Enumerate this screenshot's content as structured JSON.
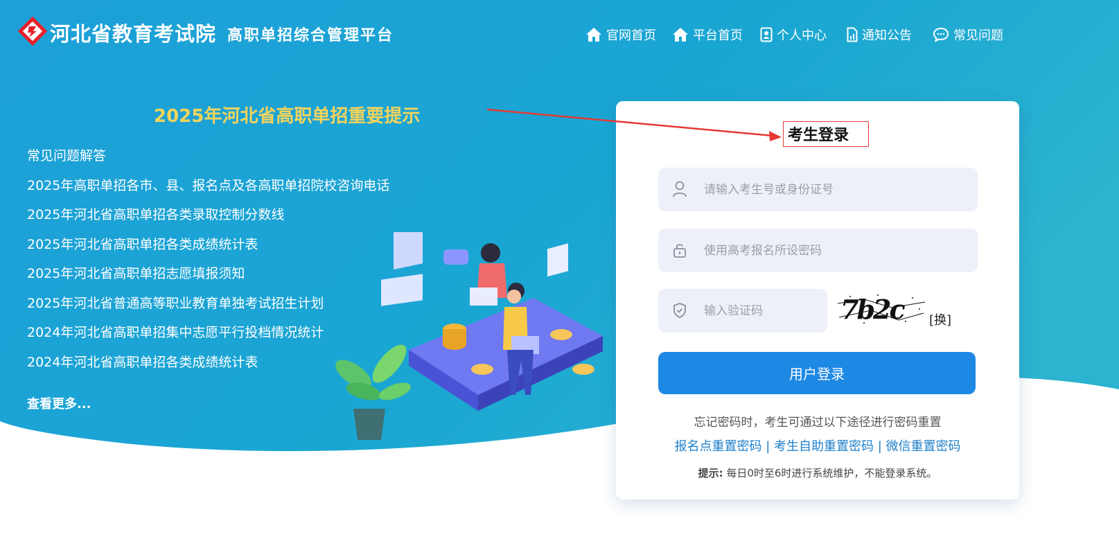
{
  "header": {
    "org_name": "河北省教育考试院",
    "platform_name": "高职单招综合管理平台",
    "nav": [
      {
        "label": "官网首页",
        "icon": "home-icon"
      },
      {
        "label": "平台首页",
        "icon": "home-icon"
      },
      {
        "label": "个人中心",
        "icon": "user-card-icon"
      },
      {
        "label": "通知公告",
        "icon": "document-icon"
      },
      {
        "label": "常见问题",
        "icon": "chat-bubble-icon"
      }
    ]
  },
  "notices": {
    "title": "2025年河北省高职单招重要提示",
    "items": [
      "常见问题解答",
      "2025年高职单招各市、县、报名点及各高职单招院校咨询电话",
      "2025年河北省高职单招各类录取控制分数线",
      "2025年河北省高职单招各类成绩统计表",
      "2025年河北省高职单招志愿填报须知",
      "2025年河北省普通高等职业教育单独考试招生计划",
      "2024年河北省高职单招集中志愿平行投档情况统计",
      "2024年河北省高职单招各类成绩统计表"
    ],
    "more": "查看更多..."
  },
  "login": {
    "title": "考生登录",
    "username_placeholder": "请输入考生号或身份证号",
    "password_placeholder": "使用高考报名所设密码",
    "captcha_placeholder": "输入验证码",
    "captcha_text": "7b2c",
    "captcha_refresh": "[换]",
    "submit": "用户登录",
    "forgot_text": "忘记密码时，考生可通过以下途径进行密码重置",
    "reset_links": [
      "报名点重置密码",
      "考生自助重置密码",
      "微信重置密码"
    ],
    "reset_separator": "|",
    "tip_label": "提示:",
    "tip_text": "每日0时至6时进行系统维护，不能登录系统。"
  },
  "colors": {
    "bg_blue": "#1ea3d6",
    "notice_title": "#f5d45c",
    "button": "#1e88e5",
    "link": "#1e7fc9",
    "annotation": "#e53935"
  }
}
